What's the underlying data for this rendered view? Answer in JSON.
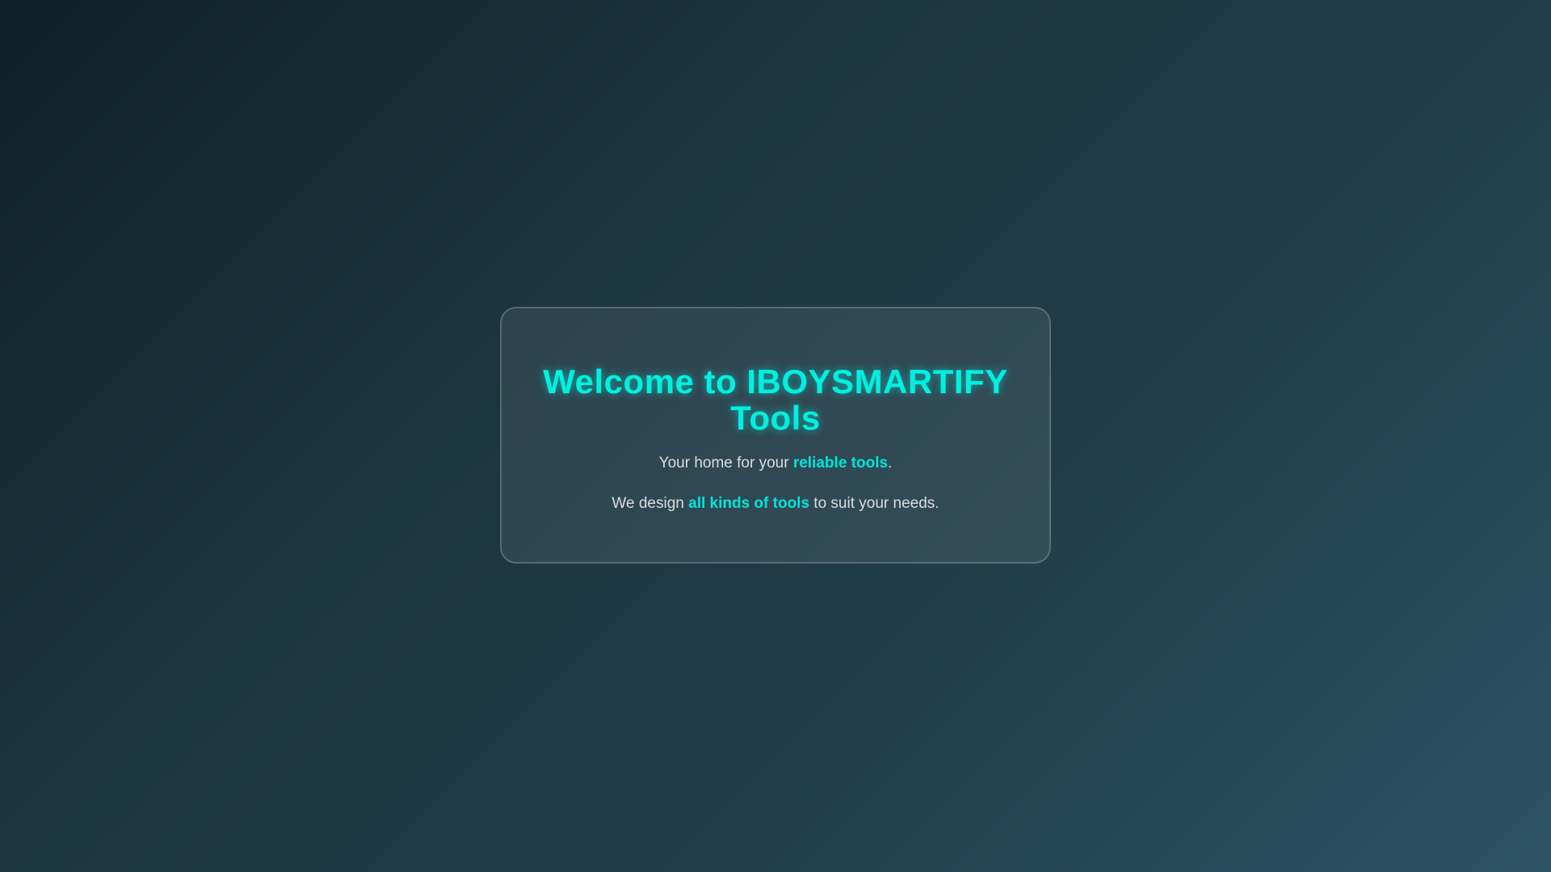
{
  "card": {
    "title_line1": "Welcome to IBOYSMARTIFY",
    "title_line2": "Tools",
    "tagline": {
      "before": "Your home for your ",
      "highlight": "reliable tools",
      "after": "."
    },
    "description": {
      "before": "We design ",
      "highlight": "all kinds of tools",
      "after": " to suit your needs."
    }
  },
  "colors": {
    "accent": "#00f0e0",
    "background_start": "#0f2027",
    "background_end": "#2c5364",
    "body_text": "#d9dde0"
  }
}
